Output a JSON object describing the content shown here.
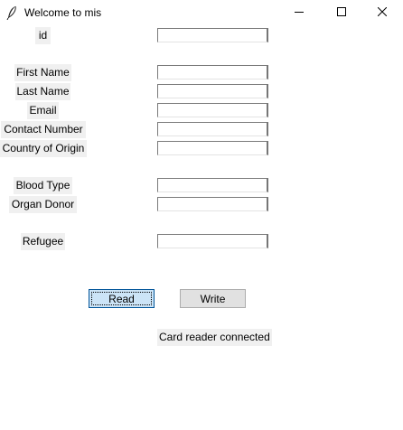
{
  "window": {
    "title": "Welcome to mis",
    "app_icon": "feather-icon",
    "controls": [
      "minimize-icon",
      "maximize-icon",
      "close-icon"
    ]
  },
  "form": {
    "fields": [
      {
        "key": "id",
        "label": "id",
        "value": ""
      },
      {
        "key": "first_name",
        "label": "First Name",
        "value": ""
      },
      {
        "key": "last_name",
        "label": "Last Name",
        "value": ""
      },
      {
        "key": "email",
        "label": "Email",
        "value": ""
      },
      {
        "key": "contact_number",
        "label": "Contact Number",
        "value": ""
      },
      {
        "key": "country_of_origin",
        "label": "Country of Origin",
        "value": ""
      },
      {
        "key": "blood_type",
        "label": "Blood Type",
        "value": ""
      },
      {
        "key": "organ_donor",
        "label": "Organ Donor",
        "value": ""
      },
      {
        "key": "refugee",
        "label": "Refugee",
        "value": ""
      }
    ]
  },
  "actions": {
    "read_label": "Read",
    "write_label": "Write"
  },
  "status": {
    "text": "Card reader connected"
  },
  "colors": {
    "read_button_bg": "#cce4f7",
    "read_button_border": "#005499",
    "write_button_bg": "#e1e1e1",
    "label_bg": "#f0f0f0"
  }
}
